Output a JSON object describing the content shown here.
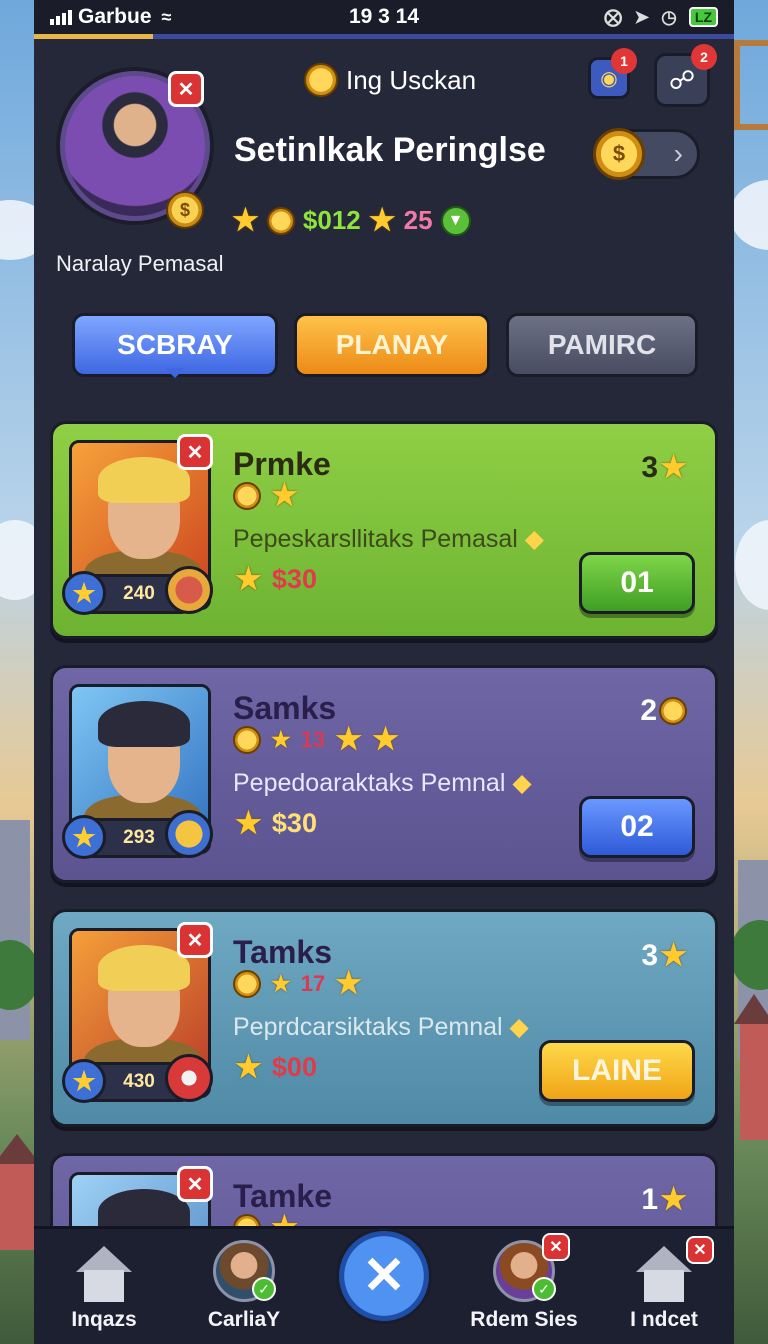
{
  "status_bar": {
    "carrier": "Garbue",
    "time": "19 3 14",
    "battery": "LZ"
  },
  "header": {
    "player_name": "Naralay Pemasal",
    "app_title": "Ing Usckan",
    "big_title": "Setinlkak Peringlse",
    "money": "$012",
    "count": "25",
    "notif_1": "1",
    "notif_2": "2",
    "avatar_coin": "$",
    "toggle_coin": "$"
  },
  "tabs": [
    {
      "label": "SCBRAY"
    },
    {
      "label": "PLANAY"
    },
    {
      "label": "PAMIRC"
    }
  ],
  "cards": [
    {
      "title": "Prmke",
      "subtitle": "Pepeskarsllitaks Pemasal",
      "reward": "$30",
      "rank": "3",
      "level": "240",
      "action": "01",
      "row_count": ""
    },
    {
      "title": "Samks",
      "subtitle": "Pepedoaraktaks Pemnal",
      "reward": "$30",
      "rank": "2",
      "level": "293",
      "action": "02",
      "row_count": "13"
    },
    {
      "title": "Tamks",
      "subtitle": "Peprdcarsiktaks Pemnal",
      "reward": "$00",
      "rank": "3",
      "level": "430",
      "action": "LAINE",
      "row_count": "17"
    },
    {
      "title": "Tamke",
      "rank": "1"
    }
  ],
  "bottom_nav": [
    {
      "label": "Inqazs"
    },
    {
      "label": "CarliaY"
    },
    {
      "label": ""
    },
    {
      "label": "Rdem Sies"
    },
    {
      "label": "I ndcet"
    }
  ],
  "icons": {
    "close": "✕",
    "star": "★",
    "chevron": "›",
    "check": "✓",
    "diamond": "◆"
  },
  "colors": {
    "panel": "#252839",
    "card_green": "#7ec03c",
    "card_purple": "#655ea0",
    "card_teal": "#5f9ab6",
    "tab_blue": "#4f74ea",
    "tab_orange": "#f29a1f",
    "tab_gray": "#575b70"
  }
}
